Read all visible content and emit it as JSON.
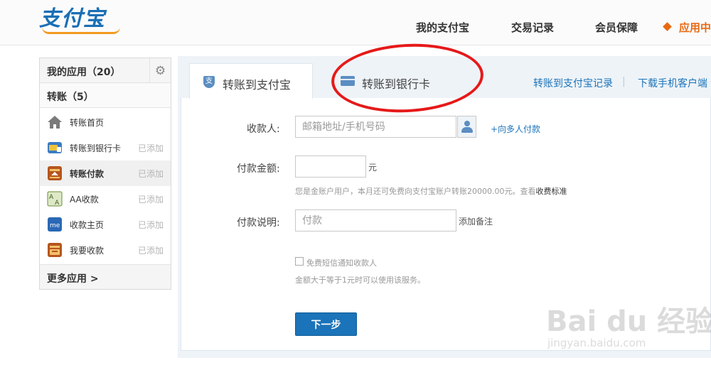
{
  "logo": {
    "text": "支付宝"
  },
  "nav": [
    {
      "label": "我的支付宝"
    },
    {
      "label": "交易记录"
    },
    {
      "label": "会员保障"
    },
    {
      "label": "应用中"
    }
  ],
  "sidebar": {
    "title": "我的应用（20）",
    "section_title": "转账（5）",
    "items": [
      {
        "label": "转账首页",
        "status": "",
        "icon": "home-icon"
      },
      {
        "label": "转账到银行卡",
        "status": "已添加",
        "icon": "bank-card-app-icon"
      },
      {
        "label": "转账付款",
        "status": "已添加",
        "icon": "transfer-payment-icon"
      },
      {
        "label": "AA收款",
        "status": "已添加",
        "icon": "aa-collect-icon"
      },
      {
        "label": "收款主页",
        "status": "已添加",
        "icon": "collect-home-icon"
      },
      {
        "label": "我要收款",
        "status": "已添加",
        "icon": "receive-money-icon"
      }
    ],
    "more": "更多应用 >"
  },
  "tabs": {
    "active": "转账到支付宝",
    "inactive": "转账到银行卡"
  },
  "top_links": {
    "records": "转账到支付宝记录",
    "separator": "|",
    "download": "下载手机客户端 ▾"
  },
  "form": {
    "payee_label": "收款人:",
    "payee_placeholder": "邮箱地址/手机号码",
    "multi_payee": "+向多人付款",
    "amount_label": "付款金额:",
    "amount_unit": "元",
    "amount_hint": "您是金账户用户，本月还可免费向支付宝账户转账20000.00元。查看",
    "amount_hint_link": "收费标准",
    "note_label": "付款说明:",
    "note_placeholder": "付款",
    "add_note": "添加备注",
    "sms_label": "免费短信通知收款人",
    "sms_hint": "金额大于等于1元时可以使用该服务。",
    "next_button": "下一步"
  },
  "watermark": {
    "main": "Bai du 经验",
    "sub": "jingyan.baidu.com"
  },
  "colors": {
    "accent_blue": "#1b73b9",
    "nav_active": "#e86a13",
    "annotation_red": "#e61919"
  }
}
